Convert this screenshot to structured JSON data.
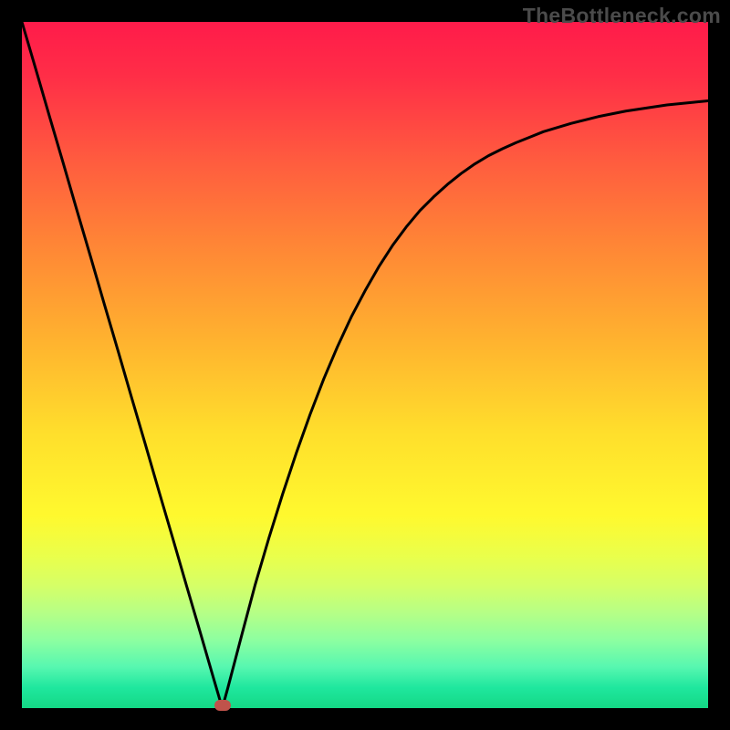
{
  "watermark": "TheBottleneck.com",
  "chart_data": {
    "type": "line",
    "title": "",
    "xlabel": "",
    "ylabel": "",
    "xlim": [
      0,
      1
    ],
    "ylim": [
      0,
      1
    ],
    "x": [
      0.0,
      0.02,
      0.04,
      0.06,
      0.08,
      0.1,
      0.12,
      0.14,
      0.16,
      0.18,
      0.2,
      0.22,
      0.24,
      0.26,
      0.28,
      0.292,
      0.3,
      0.32,
      0.34,
      0.36,
      0.38,
      0.4,
      0.42,
      0.44,
      0.46,
      0.48,
      0.5,
      0.52,
      0.54,
      0.56,
      0.58,
      0.6,
      0.62,
      0.64,
      0.66,
      0.68,
      0.7,
      0.72,
      0.74,
      0.76,
      0.78,
      0.8,
      0.82,
      0.84,
      0.86,
      0.88,
      0.9,
      0.92,
      0.94,
      0.96,
      0.98,
      1.0
    ],
    "y": [
      1.0,
      0.932,
      0.863,
      0.795,
      0.726,
      0.658,
      0.589,
      0.521,
      0.452,
      0.384,
      0.315,
      0.247,
      0.178,
      0.11,
      0.041,
      0.0,
      0.029,
      0.105,
      0.18,
      0.248,
      0.312,
      0.372,
      0.428,
      0.48,
      0.527,
      0.57,
      0.608,
      0.643,
      0.674,
      0.701,
      0.725,
      0.745,
      0.763,
      0.779,
      0.793,
      0.805,
      0.815,
      0.824,
      0.832,
      0.84,
      0.846,
      0.852,
      0.857,
      0.862,
      0.866,
      0.87,
      0.873,
      0.876,
      0.879,
      0.881,
      0.883,
      0.885
    ],
    "min_point": {
      "x": 0.292,
      "y": 0.0
    },
    "curve_color": "#000000",
    "curve_width": 3,
    "background_gradient": {
      "top": "#ff1b4a",
      "middle": "#ffe52c",
      "bottom": "#14d885"
    },
    "axes_visible": false,
    "grid": false
  }
}
